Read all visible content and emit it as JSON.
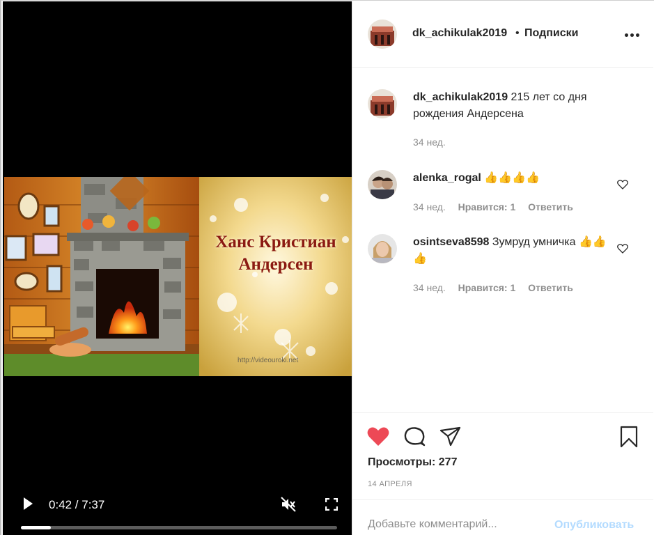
{
  "video": {
    "title_line1": "Ханс Кристиан",
    "title_line2": "Андерсен",
    "watermark": "http://videouroki.net",
    "time": "0:42 / 7:37",
    "progress_fraction": 0.095
  },
  "header": {
    "username": "dk_achikulak2019",
    "separator": "•",
    "follow_label": "Подписки"
  },
  "caption": {
    "username": "dk_achikulak2019",
    "text": "215 лет со дня рождения Андерсена",
    "time": "34 нед."
  },
  "comments": [
    {
      "username": "alenka_rogal",
      "text": "👍👍👍👍",
      "time": "34 нед.",
      "likes": "Нравится: 1",
      "reply": "Ответить"
    },
    {
      "username": "osintseva8598",
      "text": "Зумруд умничка 👍👍👍",
      "time": "34 нед.",
      "likes": "Нравится: 1",
      "reply": "Ответить"
    }
  ],
  "actions": {
    "views": "Просмотры: 277",
    "date": "14 АПРЕЛЯ",
    "like_color": "#ed4956"
  },
  "add_comment": {
    "placeholder": "Добавьте комментарий...",
    "publish_label": "Опубликовать"
  },
  "icons": [
    "play-icon",
    "mute-icon",
    "fullscreen-icon",
    "more-icon",
    "heart-icon",
    "comment-icon",
    "share-icon",
    "bookmark-icon"
  ]
}
